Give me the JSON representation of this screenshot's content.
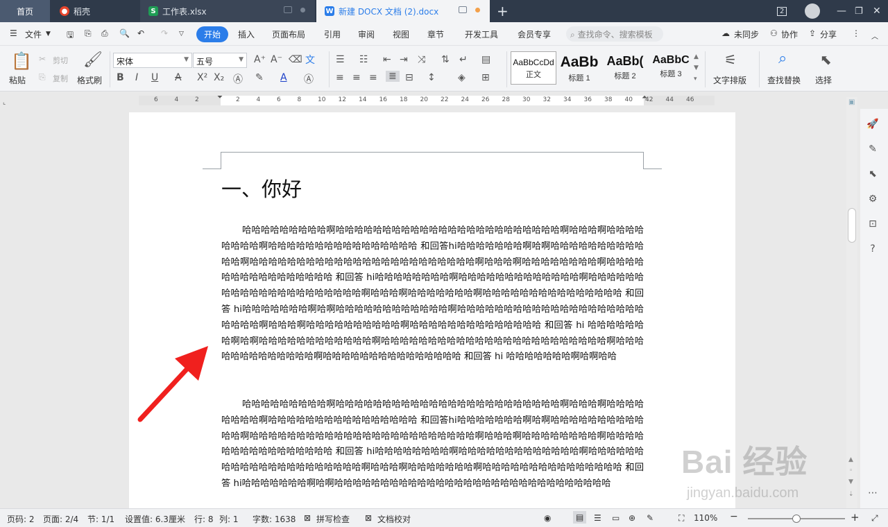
{
  "tabs": {
    "home": "首页",
    "daoke": "稻壳",
    "sheet": "工作表.xlsx",
    "doc": "新建 DOCX 文档 (2).docx",
    "badge": "2"
  },
  "menu": {
    "file": "文件",
    "items": [
      "开始",
      "插入",
      "页面布局",
      "引用",
      "审阅",
      "视图",
      "章节",
      "开发工具",
      "会员专享"
    ],
    "search": "查找命令、搜索模板",
    "sync": "未同步",
    "collab": "协作",
    "share": "分享"
  },
  "ribbon": {
    "paste": "粘贴",
    "cut": "剪切",
    "copy": "复制",
    "format_painter": "格式刷",
    "font": "宋体",
    "size": "五号",
    "styles": [
      {
        "sample": "AaBbCcDd",
        "name": "正文"
      },
      {
        "sample": "AaBb",
        "name": "标题 1"
      },
      {
        "sample": "AaBb(",
        "name": "标题 2"
      },
      {
        "sample": "AaBbC",
        "name": "标题 3"
      }
    ],
    "text_layout": "文字排版",
    "find_replace": "查找替换",
    "select": "选择"
  },
  "ruler": {
    "numbers": [
      "6",
      "4",
      "2",
      "2",
      "4",
      "6",
      "8",
      "10",
      "12",
      "14",
      "16",
      "18",
      "20",
      "22",
      "24",
      "26",
      "28",
      "30",
      "32",
      "34",
      "36",
      "38",
      "40",
      "42",
      "44",
      "46"
    ]
  },
  "document": {
    "heading": "一、你好",
    "para1": "哈哈哈哈哈哈哈哈哈啊哈哈哈哈哈哈哈哈哈哈哈哈哈哈哈哈哈哈哈哈哈哈哈哈啊哈哈哈啊哈哈哈哈哈哈哈哈啊哈哈哈哈哈哈哈哈哈哈哈哈哈哈哈哈 和回答hi哈哈哈哈哈哈哈啊哈啊哈哈哈哈哈哈哈哈哈哈哈哈啊哈哈哈哈哈哈哈哈哈哈哈哈哈哈哈哈哈哈哈哈哈哈哈哈啊哈哈哈啊哈哈哈哈哈哈哈哈啊哈哈哈哈哈哈哈哈哈哈哈哈哈哈哈哈 和回答 hi哈哈哈哈哈哈哈哈啊哈哈哈哈哈哈哈哈哈哈哈哈哈啊哈哈哈哈哈哈哈哈哈哈哈哈哈哈哈哈哈哈哈哈哈啊哈哈哈啊哈哈哈哈哈哈哈啊哈哈哈哈哈哈哈哈哈哈哈哈哈哈哈 和回答 hi哈哈哈哈哈哈哈啊哈啊哈哈哈哈哈哈哈哈哈哈哈哈啊哈哈哈哈哈哈哈哈哈哈哈哈哈哈哈哈哈哈哈哈哈哈哈哈啊哈哈哈啊哈哈哈哈哈哈哈哈哈哈啊哈哈哈哈哈哈哈哈哈哈哈哈哈哈 和回答 hi 哈哈哈哈哈哈哈啊哈啊哈哈哈哈哈哈哈哈哈哈哈哈啊哈哈哈哈哈哈哈哈哈哈哈哈哈哈哈哈哈哈哈哈哈哈哈哈啊哈哈哈哈哈哈哈哈哈哈哈哈哈啊哈哈哈哈哈哈哈哈哈哈哈哈哈哈哈 和回答 hi 哈哈哈哈哈哈哈啊哈啊哈哈",
    "para2": "哈哈哈哈哈哈哈哈哈啊哈哈哈哈哈哈哈哈哈哈哈哈哈哈哈哈哈哈哈哈哈哈哈哈啊哈哈哈啊哈哈哈哈哈哈哈哈啊哈哈哈哈哈哈哈哈哈哈哈哈哈哈哈哈 和回答hi哈哈哈哈哈哈哈啊哈啊哈哈哈哈哈哈哈哈哈哈哈哈啊哈哈哈哈哈哈哈哈哈哈哈哈哈哈哈哈哈哈哈哈哈哈哈哈啊哈哈哈啊哈哈哈哈哈哈哈哈啊哈哈哈哈哈哈哈哈哈哈哈哈哈哈哈哈 和回答 hi哈哈哈哈哈哈哈哈啊哈哈哈哈哈哈哈哈哈哈哈哈哈啊哈哈哈哈哈哈哈哈哈哈哈哈哈哈哈哈哈哈哈哈哈啊哈哈哈啊哈哈哈哈哈哈哈啊哈哈哈哈哈哈哈哈哈哈哈哈哈哈哈 和回答 hi哈哈哈哈哈哈哈啊哈啊哈哈哈哈哈哈哈哈哈哈哈哈哈哈哈哈哈哈哈哈哈哈哈哈哈哈哈哈哈哈"
  },
  "statusbar": {
    "page_code": "页码: 2",
    "page": "页面: 2/4",
    "section": "节: 1/1",
    "setting": "设置值: 6.3厘米",
    "row": "行: 8",
    "col": "列: 1",
    "word_count": "字数: 1638",
    "spell_check": "拼写检查",
    "doc_proof": "文档校对",
    "zoom": "110%"
  },
  "watermark": {
    "brand": "Bai 经验",
    "url": "jingyan.baidu.com"
  },
  "colors": {
    "accent": "#2b7de9",
    "annotation_arrow": "#f0201e",
    "titlebar": "#2f3a4a"
  }
}
